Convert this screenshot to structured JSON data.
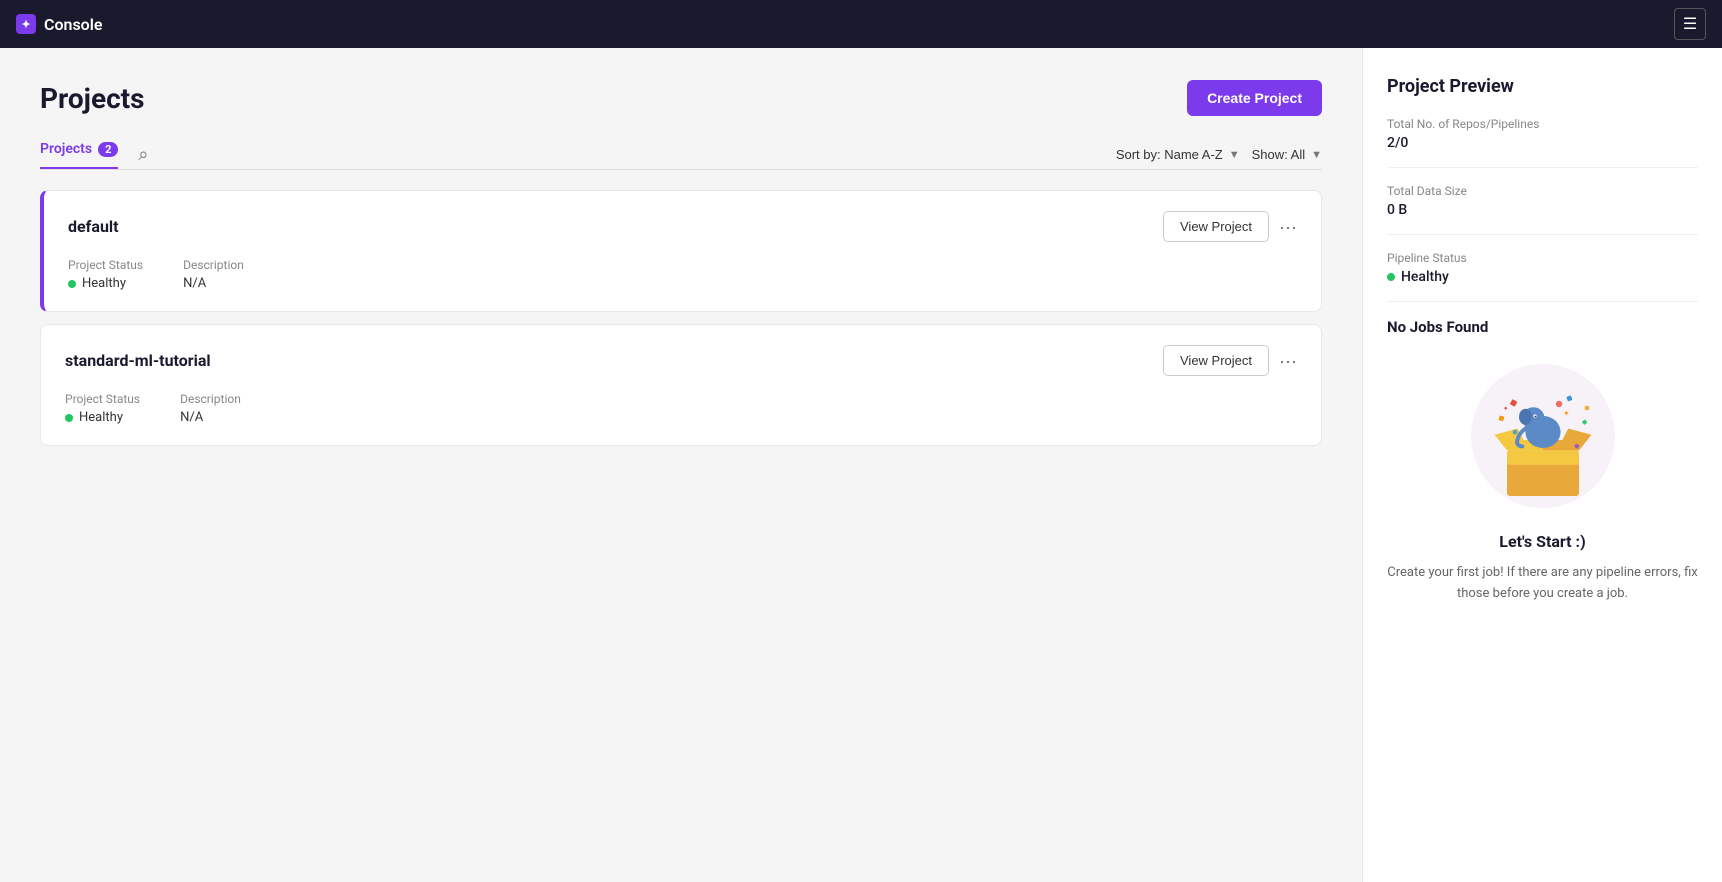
{
  "app": {
    "title": "Console",
    "brand_icon": "✦"
  },
  "topnav": {
    "menu_icon": "☰"
  },
  "page": {
    "title": "Projects",
    "create_button_label": "Create Project"
  },
  "tabs": {
    "projects_tab_label": "Projects",
    "projects_tab_count": "2",
    "search_icon": "🔍"
  },
  "filters": {
    "sort_label": "Sort by: Name A-Z",
    "show_label": "Show: All"
  },
  "projects": [
    {
      "name": "default",
      "status_label": "Project Status",
      "status_value": "Healthy",
      "description_label": "Description",
      "description_value": "N/A",
      "view_button_label": "View  Project",
      "more_icon": "•••",
      "selected": true
    },
    {
      "name": "standard-ml-tutorial",
      "status_label": "Project Status",
      "status_value": "Healthy",
      "description_label": "Description",
      "description_value": "N/A",
      "view_button_label": "View  Project",
      "more_icon": "•••",
      "selected": false
    }
  ],
  "preview_panel": {
    "title": "Project Preview",
    "total_repos_label": "Total No. of Repos/Pipelines",
    "total_repos_value": "2/0",
    "total_data_size_label": "Total Data Size",
    "total_data_size_value": "0 B",
    "pipeline_status_label": "Pipeline Status",
    "pipeline_status_value": "Healthy",
    "no_jobs_title": "No Jobs Found",
    "lets_start_title": "Let's Start :)",
    "lets_start_desc": "Create your first job! If there are any pipeline errors, fix those before you create a job."
  }
}
